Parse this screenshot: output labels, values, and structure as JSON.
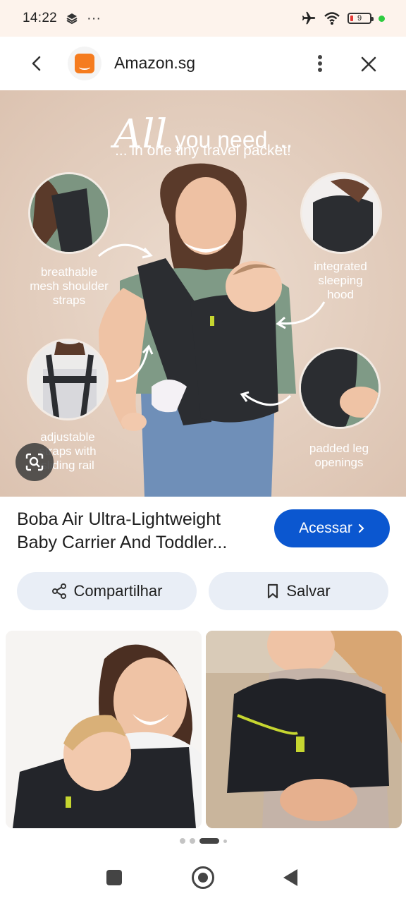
{
  "status_bar": {
    "time": "14:22",
    "overflow": "···",
    "battery_level": "9",
    "icons": [
      "app-notification-icon",
      "airplane-mode-icon",
      "wifi-icon",
      "battery-icon",
      "active-dot-icon"
    ]
  },
  "app_bar": {
    "title": "Amazon.sg",
    "logo_icon": "amazon-icon"
  },
  "hero": {
    "headline_all": "All",
    "headline_rest": "you need ...",
    "subheadline": "... in one tiny travel packet!",
    "captions": {
      "shoulder": "breathable\nmesh shoulder\nstraps",
      "hood": "integrated\nsleeping\nhood",
      "straps": "adjustable\nstraps with\nsliding rail",
      "leg": "padded leg\nopenings"
    }
  },
  "product": {
    "title": "Boba Air Ultra-Lightweight Baby Carrier And Toddler...",
    "visit_label": "Acessar"
  },
  "actions": {
    "share_label": "Compartilhar",
    "save_label": "Salvar"
  },
  "colors": {
    "accent": "#0b57d0",
    "chip_bg": "#e9eef6",
    "hero_bg": "#e7d4c6",
    "brand_orange": "#f57c1f"
  }
}
